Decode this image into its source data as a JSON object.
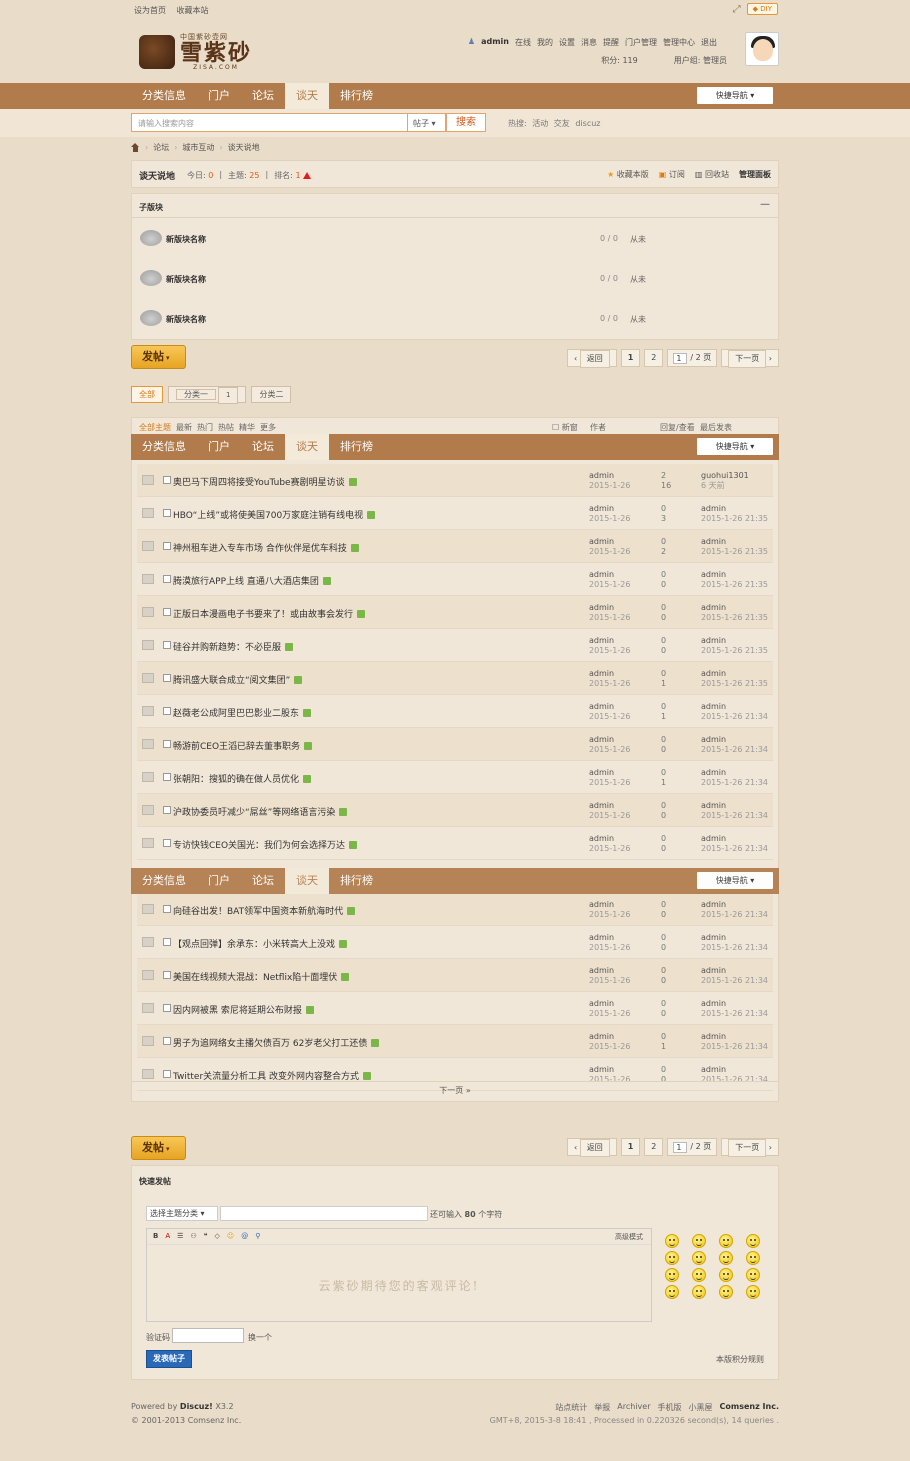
{
  "topbar": {
    "set_home": "设为首页",
    "bookmark": "收藏本站",
    "diy": "DIY"
  },
  "logo": {
    "sub": "中国紫砂壶网",
    "main": "雪紫砂",
    "domain": "ZISA.COM"
  },
  "user": {
    "name": "admin",
    "online": "在线",
    "menu": [
      "我的",
      "设置",
      "消息",
      "提醒",
      "门户管理",
      "管理中心",
      "退出"
    ],
    "points": "积分: 119",
    "group": "用户组: 管理员"
  },
  "nav": {
    "items": [
      "分类信息",
      "门户",
      "论坛",
      "谈天",
      "排行榜"
    ],
    "active": "谈天",
    "quick": "快捷导航"
  },
  "search": {
    "placeholder": "请输入搜索内容",
    "type": "帖子",
    "button": "搜索",
    "hot_label": "热搜:",
    "hot": [
      "活动",
      "交友",
      "discuz"
    ]
  },
  "breadcrumb": [
    "论坛",
    "城市互动",
    "谈天说地"
  ],
  "forum": {
    "title": "谈天说地",
    "today_label": "今日:",
    "today": "0",
    "threads_label": "主题:",
    "threads": "25",
    "rank_label": "排名:",
    "rank": "1",
    "actions": [
      "收藏本版",
      "订阅",
      "回收站",
      "管理面板"
    ]
  },
  "subforums": {
    "title": "子版块",
    "items": [
      {
        "name": "新版块名称",
        "count": "0 / 0",
        "last": "从未"
      },
      {
        "name": "新版块名称",
        "count": "0 / 0",
        "last": "从未"
      },
      {
        "name": "新版块名称",
        "count": "0 / 0",
        "last": "从未"
      }
    ]
  },
  "post_button": "发帖",
  "pager": {
    "back": "返回",
    "pages": [
      "1",
      "2"
    ],
    "current": "1",
    "total": "/ 2 页",
    "next": "下一页"
  },
  "type_tabs": [
    {
      "label": "全部",
      "on": true
    },
    {
      "label": "分类一",
      "badge": "1"
    },
    {
      "label": "分类二"
    }
  ],
  "thread_head": {
    "filters": [
      "全部主题",
      "最新",
      "热门",
      "热帖",
      "精华",
      "更多"
    ],
    "newwin": "新窗",
    "author": "作者",
    "replies": "回复/查看",
    "last": "最后发表"
  },
  "threads": [
    {
      "title": "奥巴马下周四将接受YouTube赛剧明星访谈",
      "author": "admin",
      "date": "2015-1-26",
      "rep": "2",
      "view": "16",
      "last_user": "guohui1301",
      "last_time": "6 天前"
    },
    {
      "title": "HBO“上线”或将使美国700万家庭注销有线电视",
      "author": "admin",
      "date": "2015-1-26",
      "rep": "0",
      "view": "3",
      "last_user": "admin",
      "last_time": "2015-1-26 21:35"
    },
    {
      "title": "神州租车进入专车市场 合作伙伴是优车科技",
      "author": "admin",
      "date": "2015-1-26",
      "rep": "0",
      "view": "2",
      "last_user": "admin",
      "last_time": "2015-1-26 21:35"
    },
    {
      "title": "腾漠旅行APP上线 直通八大酒店集团",
      "author": "admin",
      "date": "2015-1-26",
      "rep": "0",
      "view": "0",
      "last_user": "admin",
      "last_time": "2015-1-26 21:35"
    },
    {
      "title": "正版日本漫画电子书要来了！或由故事会发行",
      "author": "admin",
      "date": "2015-1-26",
      "rep": "0",
      "view": "0",
      "last_user": "admin",
      "last_time": "2015-1-26 21:35"
    },
    {
      "title": "硅谷并购新趋势：不必臣服",
      "author": "admin",
      "date": "2015-1-26",
      "rep": "0",
      "view": "0",
      "last_user": "admin",
      "last_time": "2015-1-26 21:35"
    },
    {
      "title": "腾讯盛大联合成立“阅文集团”",
      "author": "admin",
      "date": "2015-1-26",
      "rep": "0",
      "view": "1",
      "last_user": "admin",
      "last_time": "2015-1-26 21:35"
    },
    {
      "title": "赵薇老公成阿里巴巴影业二股东",
      "author": "admin",
      "date": "2015-1-26",
      "rep": "0",
      "view": "1",
      "last_user": "admin",
      "last_time": "2015-1-26 21:34"
    },
    {
      "title": "畅游前CEO王滔已辞去董事职务",
      "author": "admin",
      "date": "2015-1-26",
      "rep": "0",
      "view": "0",
      "last_user": "admin",
      "last_time": "2015-1-26 21:34"
    },
    {
      "title": "张朝阳：搜狐的确在做人员优化",
      "author": "admin",
      "date": "2015-1-26",
      "rep": "0",
      "view": "1",
      "last_user": "admin",
      "last_time": "2015-1-26 21:34"
    },
    {
      "title": "沪政协委员吁减少“屌丝”等网络语言污染",
      "author": "admin",
      "date": "2015-1-26",
      "rep": "0",
      "view": "0",
      "last_user": "admin",
      "last_time": "2015-1-26 21:34"
    },
    {
      "title": "专访快钱CEO关国光：我们为何会选择万达",
      "author": "admin",
      "date": "2015-1-26",
      "rep": "0",
      "view": "0",
      "last_user": "admin",
      "last_time": "2015-1-26 21:34"
    },
    {
      "title": "向硅谷出发！BAT领军中国资本新航海时代",
      "author": "admin",
      "date": "2015-1-26",
      "rep": "0",
      "view": "0",
      "last_user": "admin",
      "last_time": "2015-1-26 21:34"
    },
    {
      "title": "【观点回弹】余承东：小米转高大上没戏",
      "author": "admin",
      "date": "2015-1-26",
      "rep": "0",
      "view": "0",
      "last_user": "admin",
      "last_time": "2015-1-26 21:34"
    },
    {
      "title": "美国在线视频大混战：Netflix陷十面埋伏",
      "author": "admin",
      "date": "2015-1-26",
      "rep": "0",
      "view": "0",
      "last_user": "admin",
      "last_time": "2015-1-26 21:34"
    },
    {
      "title": "因内网被黑 索尼将延期公布财报",
      "author": "admin",
      "date": "2015-1-26",
      "rep": "0",
      "view": "0",
      "last_user": "admin",
      "last_time": "2015-1-26 21:34"
    },
    {
      "title": "男子为追网络女主播欠债百万 62岁老父打工还债",
      "author": "admin",
      "date": "2015-1-26",
      "rep": "0",
      "view": "1",
      "last_user": "admin",
      "last_time": "2015-1-26 21:34"
    },
    {
      "title": "Twitter关流量分析工具 改变外网内容整合方式",
      "author": "admin",
      "date": "2015-1-26",
      "rep": "0",
      "view": "0",
      "last_user": "admin",
      "last_time": "2015-1-26 21:34"
    }
  ],
  "list_next": "下一页 »",
  "fastpost": {
    "title": "快速发帖",
    "type_select": "选择主题分类",
    "limit_prefix": "还可输入",
    "limit_num": "80",
    "limit_suffix": "个字符",
    "toolbar": [
      "B",
      "A",
      "☰",
      "⚇",
      "❝",
      "◇",
      "☺",
      "@",
      "⚲"
    ],
    "advanced": "高级模式",
    "placeholder": "云紫砂期待您的客观评论!",
    "captcha_label": "验证码",
    "refresh": "换一个",
    "submit": "发表帖子",
    "rules": "本版积分规则"
  },
  "footer": {
    "powered": "Powered by",
    "brand": "Discuz!",
    "version": "X3.2",
    "copyright": "© 2001-2013 Comsenz Inc.",
    "links": [
      "站点统计",
      "举报",
      "Archiver",
      "手机版",
      "小黑屋"
    ],
    "company": "Comsenz Inc.",
    "time_info": "GMT+8, 2015-3-8 18:41 , Processed in 0.220326 second(s), 14 queries ."
  }
}
